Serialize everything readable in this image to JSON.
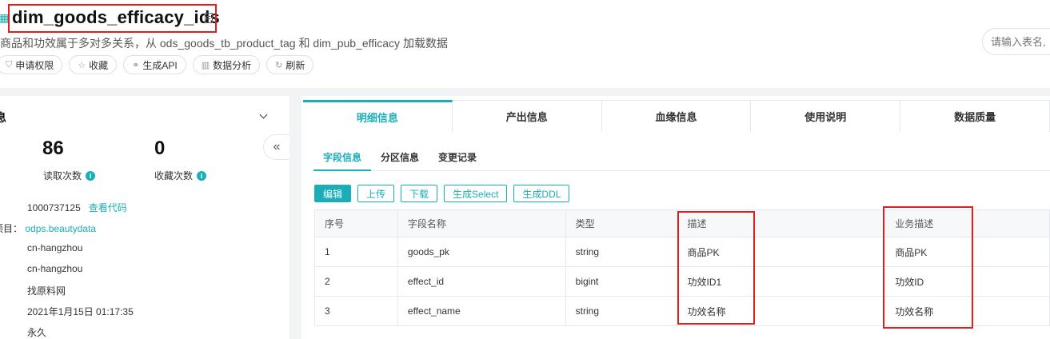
{
  "header": {
    "title": "dim_goods_efficacy_ids",
    "subtitle": "商品和功效属于多对多关系，从 ods_goods_tb_product_tag 和 dim_pub_efficacy 加载数据",
    "search_placeholder": "请输入表名,",
    "actions": [
      {
        "label": "申请权限",
        "icon": "shield-icon"
      },
      {
        "label": "收藏",
        "icon": "star-icon"
      },
      {
        "label": "生成API",
        "icon": "link-icon"
      },
      {
        "label": "数据分析",
        "icon": "bar-chart-icon"
      },
      {
        "label": "刷新",
        "icon": "refresh-icon"
      }
    ]
  },
  "left": {
    "heading": "息",
    "stats": [
      {
        "value": "86",
        "label": "读取次数"
      },
      {
        "value": "0",
        "label": "收藏次数"
      }
    ],
    "details": {
      "id": "1000737125",
      "view_code": "查看代码",
      "project_label": "项目：",
      "project": "odps.beautydata",
      "region1": "cn-hangzhou",
      "region2": "cn-hangzhou",
      "owner": "找原料网",
      "created": "2021年1月15日 01:17:35",
      "lifecycle": "永久"
    }
  },
  "tabs": [
    "明细信息",
    "产出信息",
    "血缘信息",
    "使用说明",
    "数据质量"
  ],
  "subtabs": [
    "字段信息",
    "分区信息",
    "变更记录"
  ],
  "toolbar": [
    "编辑",
    "上传",
    "下载",
    "生成Select",
    "生成DDL"
  ],
  "table": {
    "headers": [
      "序号",
      "字段名称",
      "类型",
      "描述",
      "业务描述"
    ],
    "rows": [
      [
        "1",
        "goods_pk",
        "string",
        "商品PK",
        "商品PK"
      ],
      [
        "2",
        "effect_id",
        "bigint",
        "功效ID1",
        "功效ID"
      ],
      [
        "3",
        "effect_name",
        "string",
        "功效名称",
        "功效名称"
      ]
    ]
  },
  "colors": {
    "accent": "#1aaeb8",
    "highlight": "#e02020"
  }
}
